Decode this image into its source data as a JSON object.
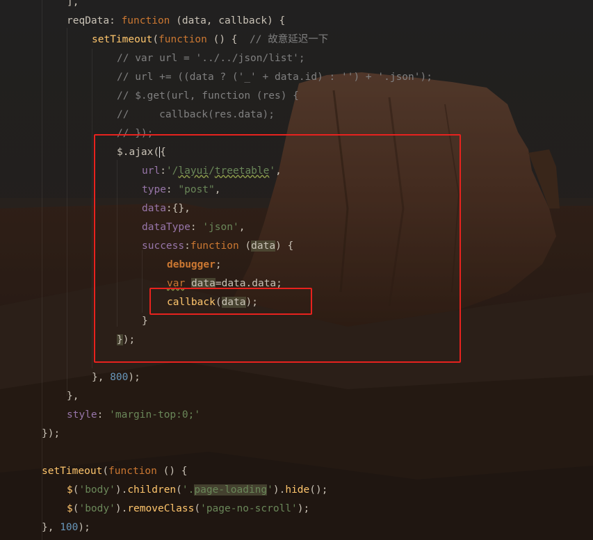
{
  "editor": {
    "lines": [
      [
        [
          "punc",
          "],"
        ]
      ],
      [
        [
          "id",
          "reqData"
        ],
        [
          "punc",
          ": "
        ],
        [
          "kw",
          "function"
        ],
        [
          "punc",
          " (data, callback) {"
        ]
      ],
      [
        [
          "fn",
          "setTimeout"
        ],
        [
          "punc",
          "("
        ],
        [
          "kw",
          "function"
        ],
        [
          "punc",
          " () {  "
        ],
        [
          "cmt",
          "// 故意延迟一下"
        ]
      ],
      [
        [
          "cmt",
          "// var url = '../../json/list';"
        ]
      ],
      [
        [
          "cmt",
          "// url += ((data ? ('_' + data.id) : '') + '.json');"
        ]
      ],
      [
        [
          "cmt",
          "// $.get(url, function (res) {"
        ]
      ],
      [
        [
          "cmt",
          "//     callback(res.data);"
        ]
      ],
      [
        [
          "cmt",
          "// });"
        ]
      ],
      [
        [
          "id",
          "$.ajax"
        ],
        [
          "punc",
          "("
        ],
        [
          "caret",
          "{"
        ]
      ],
      [
        [
          "prop",
          "url"
        ],
        [
          "punc",
          ":"
        ],
        [
          "str",
          "'/"
        ],
        [
          "strtypo",
          "layui"
        ],
        [
          "str",
          "/"
        ],
        [
          "strtypo",
          "treetable"
        ],
        [
          "str",
          "'"
        ],
        [
          "punc",
          ","
        ]
      ],
      [
        [
          "prop",
          "type"
        ],
        [
          "punc",
          ": "
        ],
        [
          "str",
          "\"post\""
        ],
        [
          "punc",
          ","
        ]
      ],
      [
        [
          "prop",
          "data"
        ],
        [
          "punc",
          ":{},"
        ]
      ],
      [
        [
          "prop",
          "dataType"
        ],
        [
          "punc",
          ": "
        ],
        [
          "str",
          "'json'"
        ],
        [
          "punc",
          ","
        ]
      ],
      [
        [
          "prop",
          "success"
        ],
        [
          "punc",
          ":"
        ],
        [
          "kw",
          "function"
        ],
        [
          "punc",
          " ("
        ],
        [
          "hlid",
          "data"
        ],
        [
          "punc",
          ") {"
        ]
      ],
      [
        [
          "dbg",
          "debugger"
        ],
        [
          "punc",
          ";"
        ]
      ],
      [
        [
          "kwtypo",
          "var"
        ],
        [
          "punc",
          " "
        ],
        [
          "hlid",
          "data"
        ],
        [
          "punc",
          "=data.data;"
        ]
      ],
      [
        [
          "fn",
          "callback"
        ],
        [
          "punc",
          "("
        ],
        [
          "hlid",
          "data"
        ],
        [
          "punc",
          ");"
        ]
      ],
      [
        [
          "punc",
          "}"
        ]
      ],
      [
        [
          "hlpunc",
          "}"
        ],
        [
          "punc",
          ");"
        ]
      ],
      [
        [
          "punc",
          ""
        ]
      ],
      [
        [
          "punc",
          "}, "
        ],
        [
          "num",
          "800"
        ],
        [
          "punc",
          ");"
        ]
      ],
      [
        [
          "punc",
          "},"
        ]
      ],
      [
        [
          "prop",
          "style"
        ],
        [
          "punc",
          ": "
        ],
        [
          "str",
          "'margin-top:0;'"
        ]
      ],
      [
        [
          "punc",
          "});"
        ]
      ],
      [
        [
          "punc",
          ""
        ]
      ],
      [
        [
          "fn",
          "setTimeout"
        ],
        [
          "punc",
          "("
        ],
        [
          "kw",
          "function"
        ],
        [
          "punc",
          " () {"
        ]
      ],
      [
        [
          "fn",
          "$"
        ],
        [
          "punc",
          "("
        ],
        [
          "str",
          "'body'"
        ],
        [
          "punc",
          ")."
        ],
        [
          "fn",
          "children"
        ],
        [
          "punc",
          "("
        ],
        [
          "str",
          "'."
        ],
        [
          "hlstr",
          "page-loading"
        ],
        [
          "str",
          "'"
        ],
        [
          "punc",
          ")."
        ],
        [
          "fn",
          "hide"
        ],
        [
          "punc",
          "();"
        ]
      ],
      [
        [
          "fn",
          "$"
        ],
        [
          "punc",
          "("
        ],
        [
          "str",
          "'body'"
        ],
        [
          "punc",
          ")."
        ],
        [
          "fn",
          "removeClass"
        ],
        [
          "punc",
          "("
        ],
        [
          "str",
          "'page-no-scroll'"
        ],
        [
          "punc",
          ");"
        ]
      ],
      [
        [
          "punc",
          "}, "
        ],
        [
          "num",
          "100"
        ],
        [
          "punc",
          ");"
        ]
      ]
    ]
  },
  "colors": {
    "annotation_box": "#e8221e",
    "keyword": "#cc7832",
    "string": "#6a8759",
    "comment": "#808080",
    "number": "#6897bb",
    "property": "#9876aa",
    "function": "#ffc66d"
  }
}
